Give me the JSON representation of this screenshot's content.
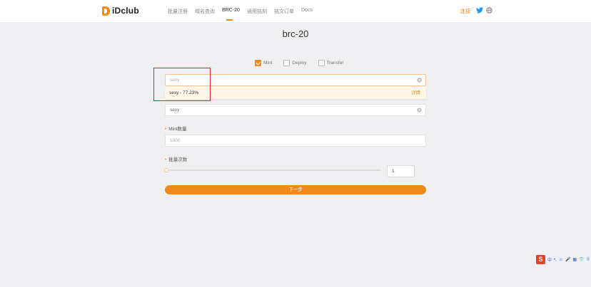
{
  "header": {
    "logo_text": "iDclub",
    "nav": [
      "批量注册",
      "域名查询",
      "BRC-20",
      "通用铭刻",
      "铭文订单",
      "Docs"
    ],
    "active_nav": "BRC-20",
    "login_label": "连接",
    "accent_color": "#f08a1c"
  },
  "page": {
    "title": "brc-20"
  },
  "operation": {
    "options": [
      {
        "label": "Mint",
        "checked": true
      },
      {
        "label": "Deploy",
        "checked": false
      },
      {
        "label": "Transfer",
        "checked": false
      }
    ]
  },
  "search": {
    "placeholder": "sexy",
    "suggestion": "sexy - 77.23%",
    "suggestion_action": "详情"
  },
  "ticker": {
    "value": "sexy"
  },
  "mint_amount": {
    "label": "Mint数量",
    "value": "1000"
  },
  "batch": {
    "label": "批量次数",
    "value": "1"
  },
  "next_button": {
    "label": "下一步"
  },
  "ime_bar": {
    "logo": "S",
    "items": [
      "中",
      "•,",
      "☺",
      "🎤",
      "▦",
      "👕",
      "⠿"
    ]
  }
}
